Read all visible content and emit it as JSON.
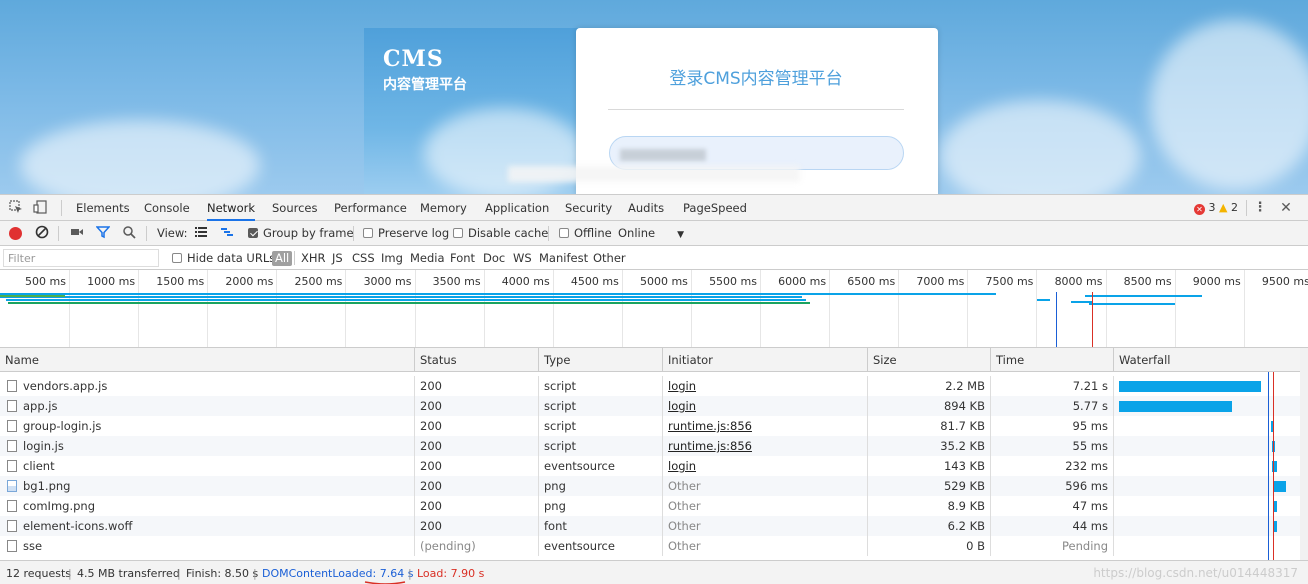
{
  "webpage": {
    "brand_logo": "CMS",
    "brand_subtitle": "内容管理平台",
    "login_title": "登录CMS内容管理平台"
  },
  "devtools": {
    "tabs": [
      "Elements",
      "Console",
      "Network",
      "Sources",
      "Performance",
      "Memory",
      "Application",
      "Security",
      "Audits",
      "PageSpeed"
    ],
    "active_tab": "Network",
    "error_count": "3",
    "warning_count": "2",
    "toolbar": {
      "view_label": "View:",
      "group_by_frame": "Group by frame",
      "preserve_log": "Preserve log",
      "disable_cache": "Disable cache",
      "offline": "Offline",
      "throttle": "Online"
    },
    "filter": {
      "placeholder": "Filter",
      "hide_data_urls": "Hide data URLs",
      "types": [
        "All",
        "XHR",
        "JS",
        "CSS",
        "Img",
        "Media",
        "Font",
        "Doc",
        "WS",
        "Manifest",
        "Other"
      ]
    },
    "overview_ticks": [
      "500 ms",
      "1000 ms",
      "1500 ms",
      "2000 ms",
      "2500 ms",
      "3000 ms",
      "3500 ms",
      "4000 ms",
      "4500 ms",
      "5000 ms",
      "5500 ms",
      "6000 ms",
      "6500 ms",
      "7000 ms",
      "7500 ms",
      "8000 ms",
      "8500 ms",
      "9000 ms",
      "9500 ms"
    ],
    "columns": [
      "Name",
      "Status",
      "Type",
      "Initiator",
      "Size",
      "Time",
      "Waterfall"
    ],
    "rows": [
      {
        "name": "vendors.app.js",
        "status": "200",
        "type": "script",
        "initiator": "login",
        "initiator_link": true,
        "size": "2.2 MB",
        "time": "7.21 s",
        "icon": "file",
        "wf_start_s": 0.0,
        "wf_end_s": 7.21
      },
      {
        "name": "app.js",
        "status": "200",
        "type": "script",
        "initiator": "login",
        "initiator_link": true,
        "size": "894 KB",
        "time": "5.77 s",
        "icon": "file",
        "wf_start_s": 0.0,
        "wf_end_s": 5.77
      },
      {
        "name": "group-login.js",
        "status": "200",
        "type": "script",
        "initiator": "runtime.js:856",
        "initiator_link": true,
        "size": "81.7 KB",
        "time": "95 ms",
        "icon": "file",
        "wf_start_s": 7.75,
        "wf_end_s": 7.85
      },
      {
        "name": "login.js",
        "status": "200",
        "type": "script",
        "initiator": "runtime.js:856",
        "initiator_link": true,
        "size": "35.2 KB",
        "time": "55 ms",
        "icon": "file",
        "wf_start_s": 7.8,
        "wf_end_s": 7.86
      },
      {
        "name": "client",
        "status": "200",
        "type": "eventsource",
        "initiator": "login",
        "initiator_link": true,
        "size": "143 KB",
        "time": "232 ms",
        "icon": "file",
        "wf_start_s": 7.8,
        "wf_end_s": 8.03
      },
      {
        "name": "bg1.png",
        "status": "200",
        "type": "png",
        "initiator": "Other",
        "initiator_link": false,
        "size": "529 KB",
        "time": "596 ms",
        "icon": "image",
        "wf_start_s": 7.88,
        "wf_end_s": 8.48
      },
      {
        "name": "comImg.png",
        "status": "200",
        "type": "png",
        "initiator": "Other",
        "initiator_link": false,
        "size": "8.9 KB",
        "time": "47 ms",
        "icon": "file",
        "wf_start_s": 7.88,
        "wf_end_s": 7.93
      },
      {
        "name": "element-icons.woff",
        "status": "200",
        "type": "font",
        "initiator": "Other",
        "initiator_link": false,
        "size": "6.2 KB",
        "time": "44 ms",
        "icon": "file",
        "wf_start_s": 7.88,
        "wf_end_s": 7.93
      },
      {
        "name": "sse",
        "status": "(pending)",
        "type": "eventsource",
        "initiator": "Other",
        "initiator_link": false,
        "size": "0 B",
        "time": "Pending",
        "icon": "file",
        "wf_start_s": null,
        "wf_end_s": null
      }
    ],
    "status_bar": {
      "requests": "12 requests",
      "transferred": "4.5 MB transferred",
      "finish": "Finish: 8.50 s",
      "dcl_prefix": "DOMContentLoaded: ",
      "dcl_value": "7.64 s",
      "load": "Load: 7.90 s"
    },
    "watermark": "https://blog.csdn.net/u014448317",
    "colors": {
      "accent": "#1a73e8",
      "waterfall_bar": "#0aa3e8",
      "dcl_line": "#1a5fd6",
      "load_line": "#d93025",
      "record": "#e03131"
    }
  }
}
